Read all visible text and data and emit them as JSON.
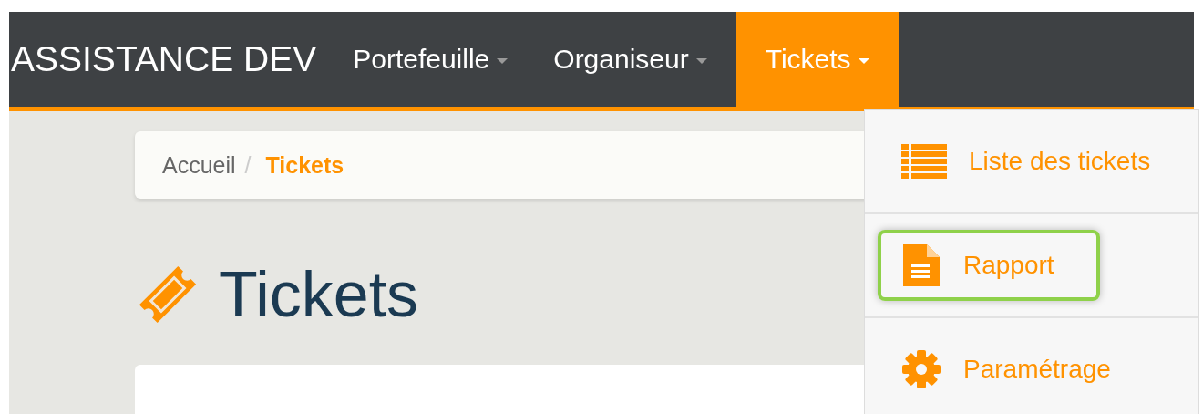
{
  "navbar": {
    "brand": "ASSISTANCE DEV",
    "items": [
      {
        "label": "Portefeuille",
        "selected": false
      },
      {
        "label": "Organiseur",
        "selected": false
      },
      {
        "label": "Tickets",
        "selected": true
      }
    ]
  },
  "dropdown": {
    "items": [
      {
        "label": "Liste des tickets",
        "kind": "list",
        "highlighted": false
      },
      {
        "label": "Rapport",
        "kind": "report",
        "highlighted": true
      },
      {
        "label": "Paramétrage",
        "kind": "settings",
        "highlighted": false
      }
    ]
  },
  "breadcrumb_separator": "/",
  "breadcrumb": [
    {
      "label": "Accueil",
      "selected": false
    },
    {
      "label": "Tickets",
      "selected": true
    }
  ],
  "page_title": "Tickets"
}
